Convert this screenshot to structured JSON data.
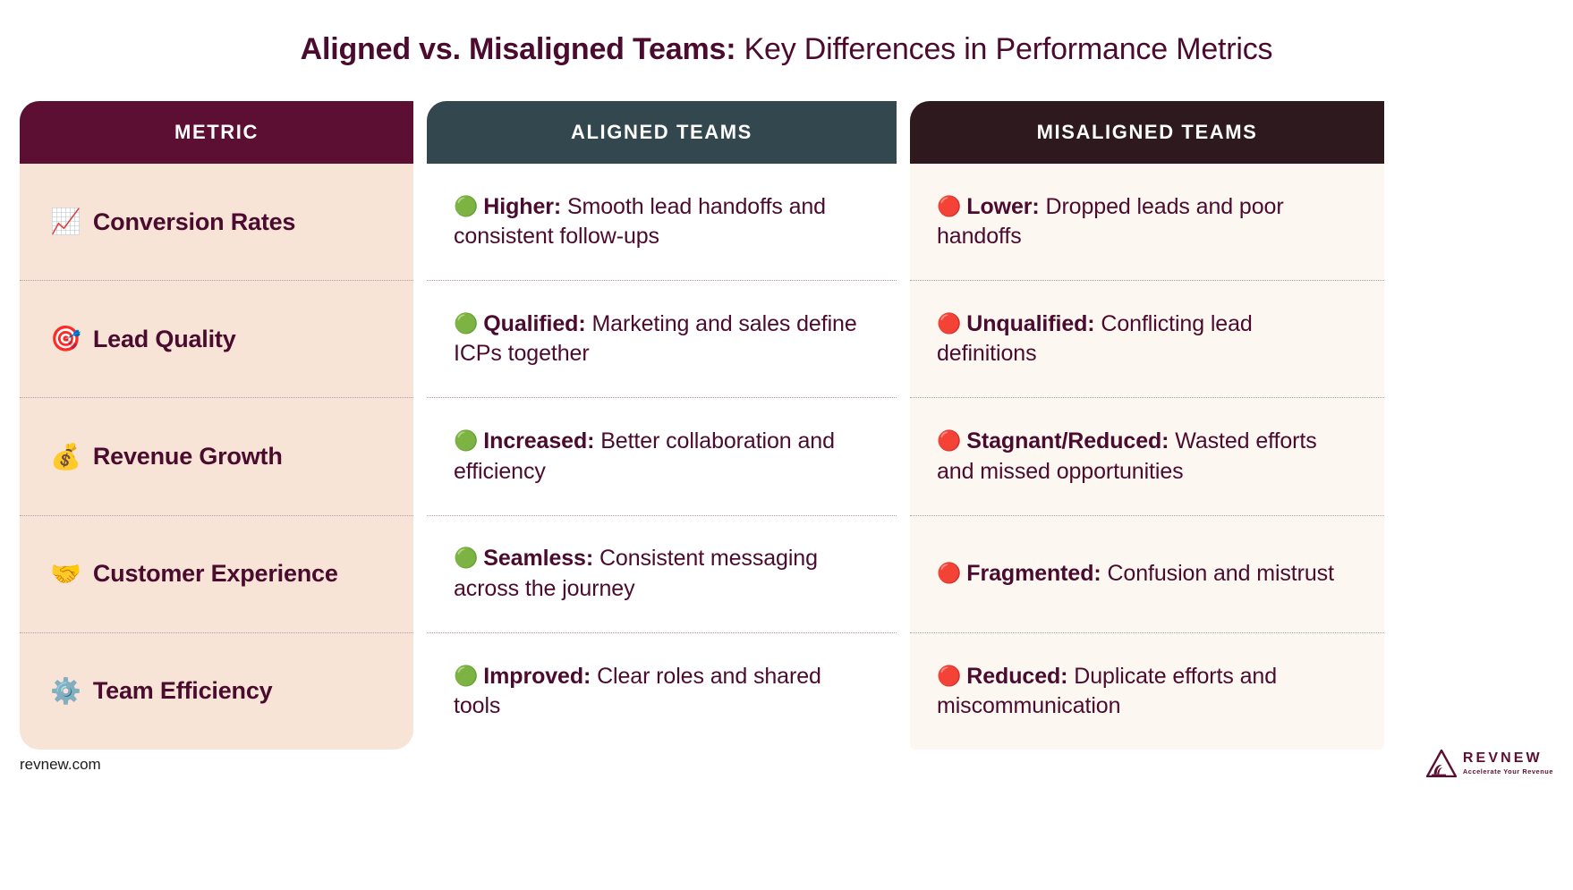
{
  "title": {
    "bold_part": "Aligned vs. Misaligned Teams:",
    "regular_part": " Key Differences in Performance Metrics"
  },
  "columns": {
    "metric_header": "METRIC",
    "aligned_header": "ALIGNED TEAMS",
    "misaligned_header": "MISALIGNED TEAMS"
  },
  "colors": {
    "metric_header_bg": "#5c0f33",
    "aligned_header_bg": "#33474f",
    "misaligned_header_bg": "#2e1a1e",
    "metric_body_bg": "#f7e4d7",
    "aligned_body_bg": "#ffffff",
    "misaligned_body_bg": "#fcf7f1",
    "text": "#4a0b2e",
    "green_dot": "#79bc3c",
    "red_dot": "#f03a2e"
  },
  "rows": [
    {
      "metric_icon": "📈",
      "metric_icon_name": "chart-increasing-icon",
      "metric": "Conversion Rates",
      "aligned": {
        "dot": "🟢",
        "dot_name": "green-circle-icon",
        "label": "Higher:",
        "desc": " Smooth lead handoffs and consistent follow-ups"
      },
      "misaligned": {
        "dot": "🔴",
        "dot_name": "red-circle-icon",
        "label": "Lower:",
        "desc": " Dropped leads and poor handoffs"
      }
    },
    {
      "metric_icon": "🎯",
      "metric_icon_name": "target-icon",
      "metric": "Lead Quality",
      "aligned": {
        "dot": "🟢",
        "dot_name": "green-circle-icon",
        "label": "Qualified:",
        "desc": " Marketing and sales define ICPs together"
      },
      "misaligned": {
        "dot": "🔴",
        "dot_name": "red-circle-icon",
        "label": "Unqualified:",
        "desc": " Conflicting lead definitions"
      }
    },
    {
      "metric_icon": "💰",
      "metric_icon_name": "money-bag-icon",
      "metric": "Revenue Growth",
      "aligned": {
        "dot": "🟢",
        "dot_name": "green-circle-icon",
        "label": "Increased:",
        "desc": " Better collaboration and efficiency"
      },
      "misaligned": {
        "dot": "🔴",
        "dot_name": "red-circle-icon",
        "label": "Stagnant/Reduced:",
        "desc": " Wasted efforts and missed opportunities"
      }
    },
    {
      "metric_icon": "🤝",
      "metric_icon_name": "handshake-icon",
      "metric": "Customer Experience",
      "aligned": {
        "dot": "🟢",
        "dot_name": "green-circle-icon",
        "label": "Seamless:",
        "desc": " Consistent messaging across the journey"
      },
      "misaligned": {
        "dot": "🔴",
        "dot_name": "red-circle-icon",
        "label": "Fragmented:",
        "desc": " Confusion and mistrust"
      }
    },
    {
      "metric_icon": "⚙️",
      "metric_icon_name": "gear-icon",
      "metric": "Team Efficiency",
      "aligned": {
        "dot": "🟢",
        "dot_name": "green-circle-icon",
        "label": "Improved:",
        "desc": " Clear roles and shared tools"
      },
      "misaligned": {
        "dot": "🔴",
        "dot_name": "red-circle-icon",
        "label": "Reduced:",
        "desc": " Duplicate efforts and miscommunication"
      }
    }
  ],
  "footer": {
    "url": "revnew.com",
    "logo_word": "REVNEW",
    "logo_tagline": "Accelerate Your Revenue"
  }
}
